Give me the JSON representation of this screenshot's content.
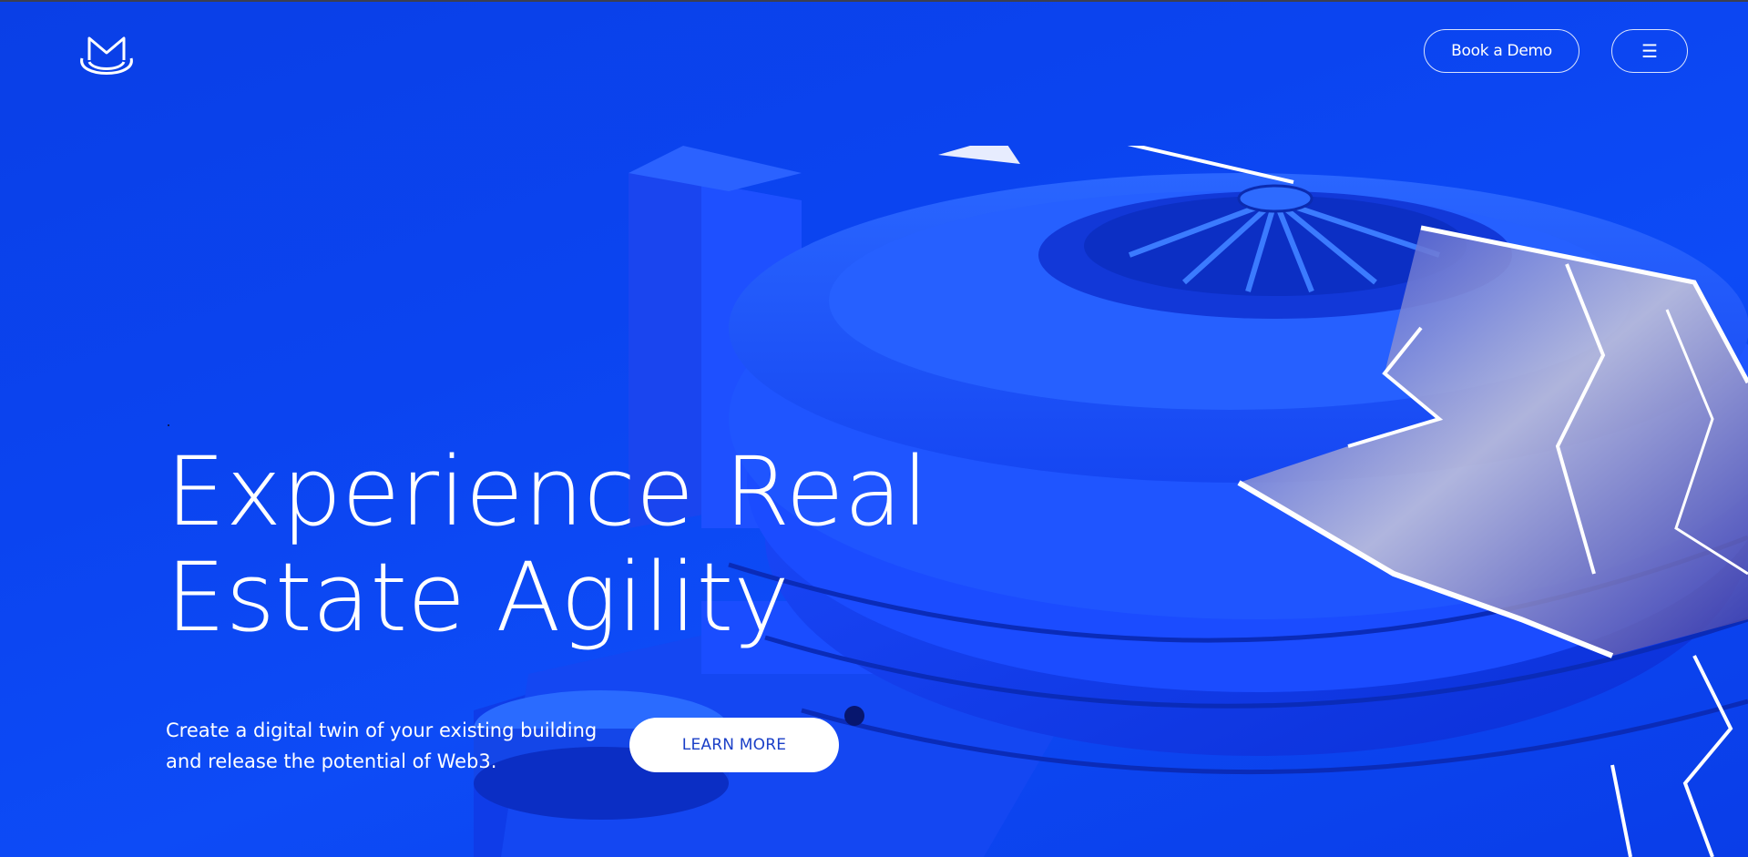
{
  "header": {
    "logo_icon": "m-hat-logo-icon",
    "book_demo_label": "Book a Demo",
    "menu_icon_glyph": "☰"
  },
  "hero": {
    "headline_line1": "Experience Real",
    "headline_line2": "Estate Agility",
    "subtext_line1": "Create a digital twin of your existing building",
    "subtext_line2": "and release the potential of Web3.",
    "cta_label": "LEARN MORE",
    "art_description_icon": "spiral-building-render"
  },
  "colors": {
    "background": "#0b44f0",
    "text": "#ffffff",
    "cta_text": "#1a3fc7"
  }
}
